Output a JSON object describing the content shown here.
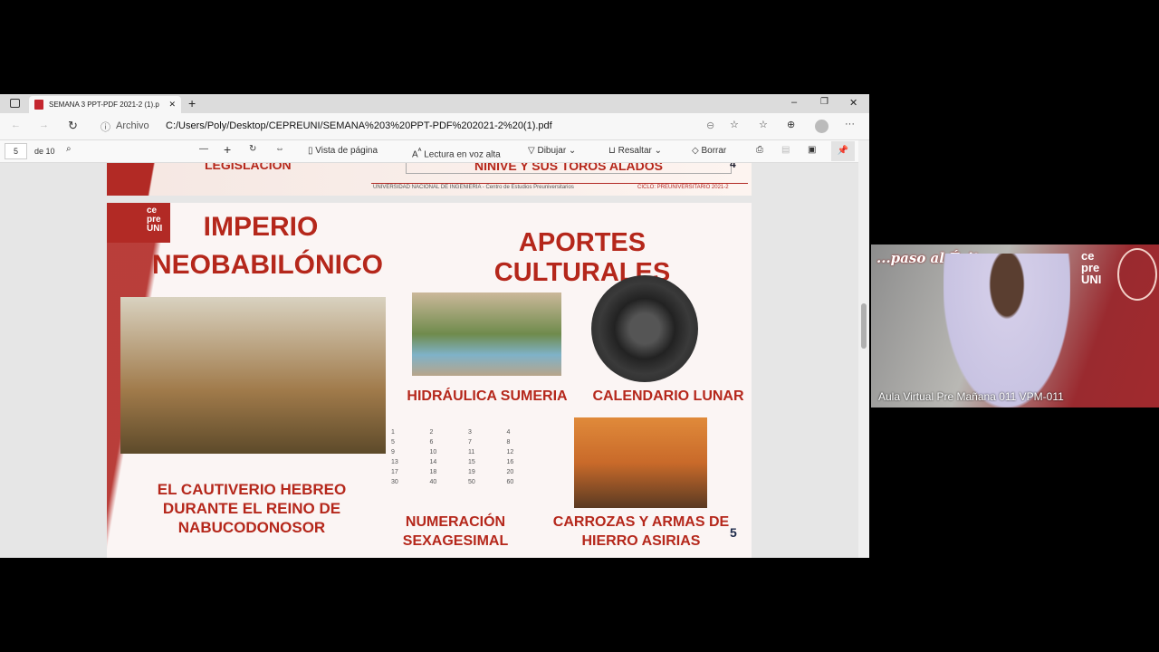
{
  "browser": {
    "tab_title": "SEMANA 3 PPT-PDF 2021-2 (1).p",
    "new_tab": "+",
    "address_label": "Archivo",
    "url": "C:/Users/Poly/Desktop/CEPREUNI/SEMANA%203%20PPT-PDF%202021-2%20(1).pdf",
    "more": "···"
  },
  "pdf_toolbar": {
    "page": "5",
    "of": "de 10",
    "page_view": "Vista de página",
    "read_aloud": "Lectura en voz alta",
    "draw": "Dibujar",
    "highlight": "Resaltar",
    "erase": "Borrar"
  },
  "prev_slide": {
    "left_title": "LEGISLACIÓN",
    "right_title": "NINIVE Y SUS TOROS ALADOS",
    "page_num": "4",
    "footer_left": "UNIVERSIDAD NACIONAL DE INGENIERÍA - Centro de Estudios Preuniversitarios",
    "footer_right": "CICLO: PREUNIVERSITARIO 2021-2"
  },
  "slide": {
    "logo": "ce pre UNI",
    "title1": "IMPERIO",
    "title2": "NEOBABILÓNICO",
    "heading": "APORTES CULTURALES",
    "captivity": "EL CAUTIVERIO HEBREO DURANTE EL REINO DE NABUCODONOSOR",
    "hydraulic": "HIDRÁULICA SUMERIA",
    "calendar": "CALENDARIO LUNAR",
    "numeration": "NUMERACIÓN SEXAGESIMAL",
    "chariots": "CARROZAS Y ARMAS DE HIERRO ASIRIAS",
    "page_num": "5",
    "numerals": [
      "1",
      "2",
      "3",
      "4",
      "5",
      "6",
      "7",
      "8",
      "9",
      "10",
      "11",
      "12",
      "13",
      "14",
      "15",
      "16",
      "17",
      "18",
      "19",
      "20",
      "30",
      "40",
      "50",
      "60"
    ]
  },
  "webcam": {
    "banner": "...paso al Éxito",
    "logo": "ce pre UNI",
    "label": "Aula Virtual Pre Mañana 011 VPM-011"
  },
  "colors": {
    "accent": "#b5271b"
  }
}
